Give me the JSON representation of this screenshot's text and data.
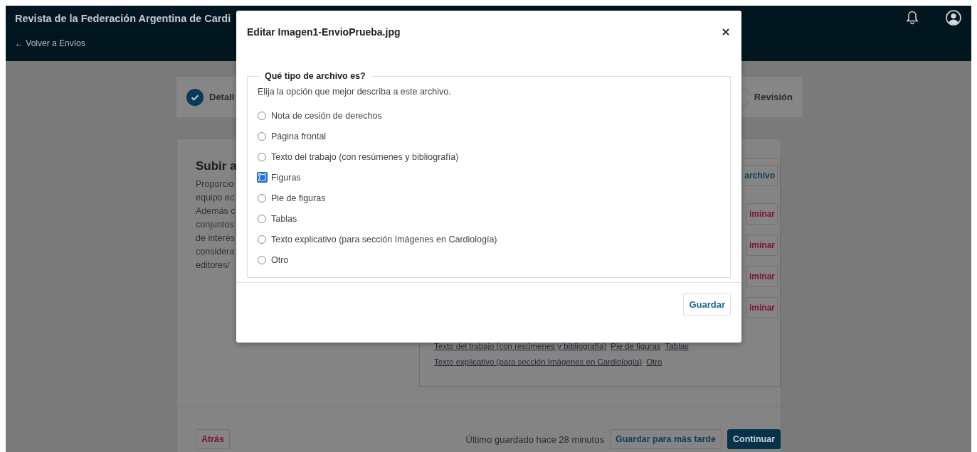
{
  "header": {
    "journal_title": "Revista de la Federación Argentina de Cardi",
    "back_link": "← Volver a Envíos"
  },
  "steps": [
    {
      "label": "Detall",
      "completed": true
    },
    {
      "label": "Revisión",
      "completed": false
    }
  ],
  "upload_section": {
    "title": "Subir a",
    "description_lines": [
      "Proporcio",
      "equipo ec",
      "Además c",
      "conjuntos",
      "de interés",
      "considera",
      "editores/"
    ],
    "actions": [
      {
        "label": "archivo",
        "kind": "primary"
      },
      {
        "label": "iminar",
        "kind": "danger"
      },
      {
        "label": "iminar",
        "kind": "danger"
      },
      {
        "label": "iminar",
        "kind": "danger"
      },
      {
        "label": "iminar",
        "kind": "danger"
      }
    ],
    "file_type_links": [
      [
        "Texto del trabajo (con resúmenes y bibliografía)",
        "Pie de figuras",
        "Tablas"
      ],
      [
        "Texto explicativo (para sección Imágenes en Cardiología)",
        "Otro"
      ]
    ]
  },
  "footer": {
    "back_button": "Atrás",
    "last_saved": "Último guardado hace 28 minutos",
    "save_later_button": "Guardar para más tarde",
    "continue_button": "Continuar"
  },
  "modal": {
    "title": "Editar Imagen1-EnvioPrueba.jpg",
    "legend": "Qué tipo de archivo es?",
    "description": "Elija la opción que mejor describa a este archivo.",
    "options": [
      {
        "label": "Nota de cesión de derechos",
        "selected": false
      },
      {
        "label": "Página frontal",
        "selected": false
      },
      {
        "label": "Texto del trabajo (con resúmenes y bibliografía)",
        "selected": false
      },
      {
        "label": "Figuras",
        "selected": true
      },
      {
        "label": "Pie de figuras",
        "selected": false
      },
      {
        "label": "Tablas",
        "selected": false
      },
      {
        "label": "Texto explicativo (para sección Imágenes en Cardiología)",
        "selected": false
      },
      {
        "label": "Otro",
        "selected": false
      }
    ],
    "save_button": "Guardar"
  }
}
